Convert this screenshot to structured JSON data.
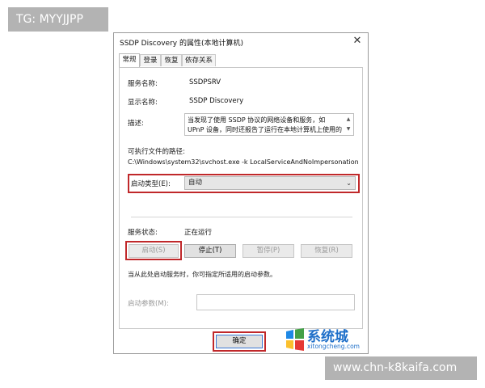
{
  "watermarks": {
    "top_left": "TG: MYYJJPP",
    "bottom_right": "www.chn-k8kaifa.com"
  },
  "dialog": {
    "title": "SSDP Discovery 的属性(本地计算机)",
    "close_glyph": "✕",
    "tabs": [
      {
        "label": "常规",
        "active": true
      },
      {
        "label": "登录",
        "active": false
      },
      {
        "label": "恢复",
        "active": false
      },
      {
        "label": "依存关系",
        "active": false
      }
    ],
    "service_name_label": "服务名称:",
    "service_name_value": "SSDPSRV",
    "display_name_label": "显示名称:",
    "display_name_value": "SSDP Discovery",
    "description_label": "描述:",
    "description_value": "当发现了使用 SSDP 协议的网络设备和服务，如 UPnP 设备，同时还报告了运行在本地计算机上使用的 SSDP",
    "exe_path_label": "可执行文件的路径:",
    "exe_path_value": "C:\\Windows\\system32\\svchost.exe -k LocalServiceAndNoImpersonation",
    "startup_type_label": "启动类型(E):",
    "startup_type_value": "自动",
    "status_label": "服务状态:",
    "status_value": "正在运行",
    "buttons": {
      "start": "启动(S)",
      "stop": "停止(T)",
      "pause": "暂停(P)",
      "resume": "恢复(R)"
    },
    "hint_text": "当从此处启动服务时，你可指定所适用的启动参数。",
    "start_params_label": "启动参数(M):",
    "start_params_value": "",
    "ok_button": "确定",
    "accent_color": "#c0282a"
  },
  "logo": {
    "title": "系统城",
    "subtitle": "xitongcheng.com"
  }
}
